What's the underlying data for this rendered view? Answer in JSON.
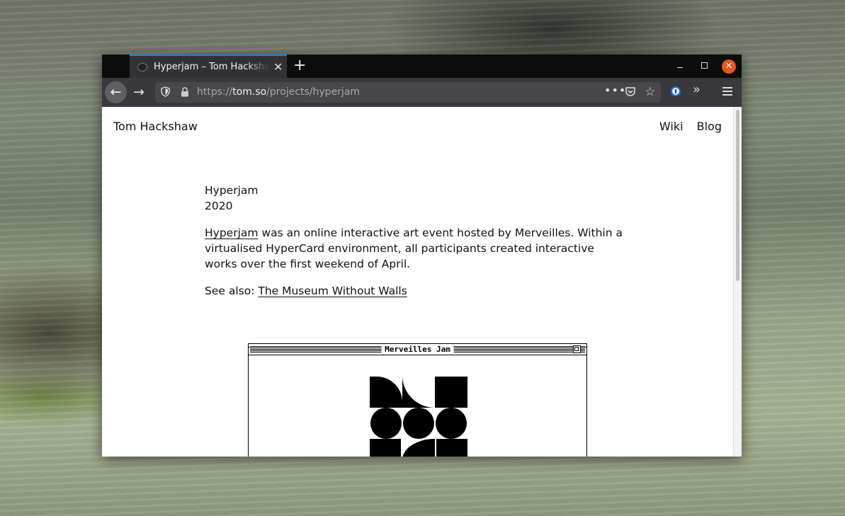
{
  "browser": {
    "tab_title": "Hyperjam – Tom Hackshaw",
    "url_scheme": "https://",
    "url_host": "tom.so",
    "url_path": "/projects/hyperjam",
    "new_tab_symbol": "+",
    "tab_close_symbol": "✕",
    "window_close_symbol": "✕"
  },
  "site": {
    "title": "Tom Hackshaw",
    "nav": [
      "Wiki",
      "Blog"
    ]
  },
  "article": {
    "heading": "Hyperjam",
    "year": "2020",
    "intro_link": "Hyperjam",
    "intro_text": " was an online interactive art event hosted by Merveilles. Within a virtualised HyperCard environment, all participants created interactive works over the first weekend of April.",
    "see_also_label": "See also: ",
    "see_also_link": "The Museum Without Walls"
  },
  "embed": {
    "window_title": "Merveilles Jam"
  },
  "icons": {
    "back": "back-arrow-icon",
    "forward": "forward-arrow-icon",
    "shield": "shield-icon",
    "lock": "lock-icon",
    "pocket": "pocket-icon",
    "star": "star-icon",
    "password_manager": "1password-icon",
    "overflow": "chevron-double-right-icon",
    "menu": "hamburger-menu-icon"
  },
  "colors": {
    "tab_accent": "#0a84ff",
    "close_button": "#e95420"
  }
}
